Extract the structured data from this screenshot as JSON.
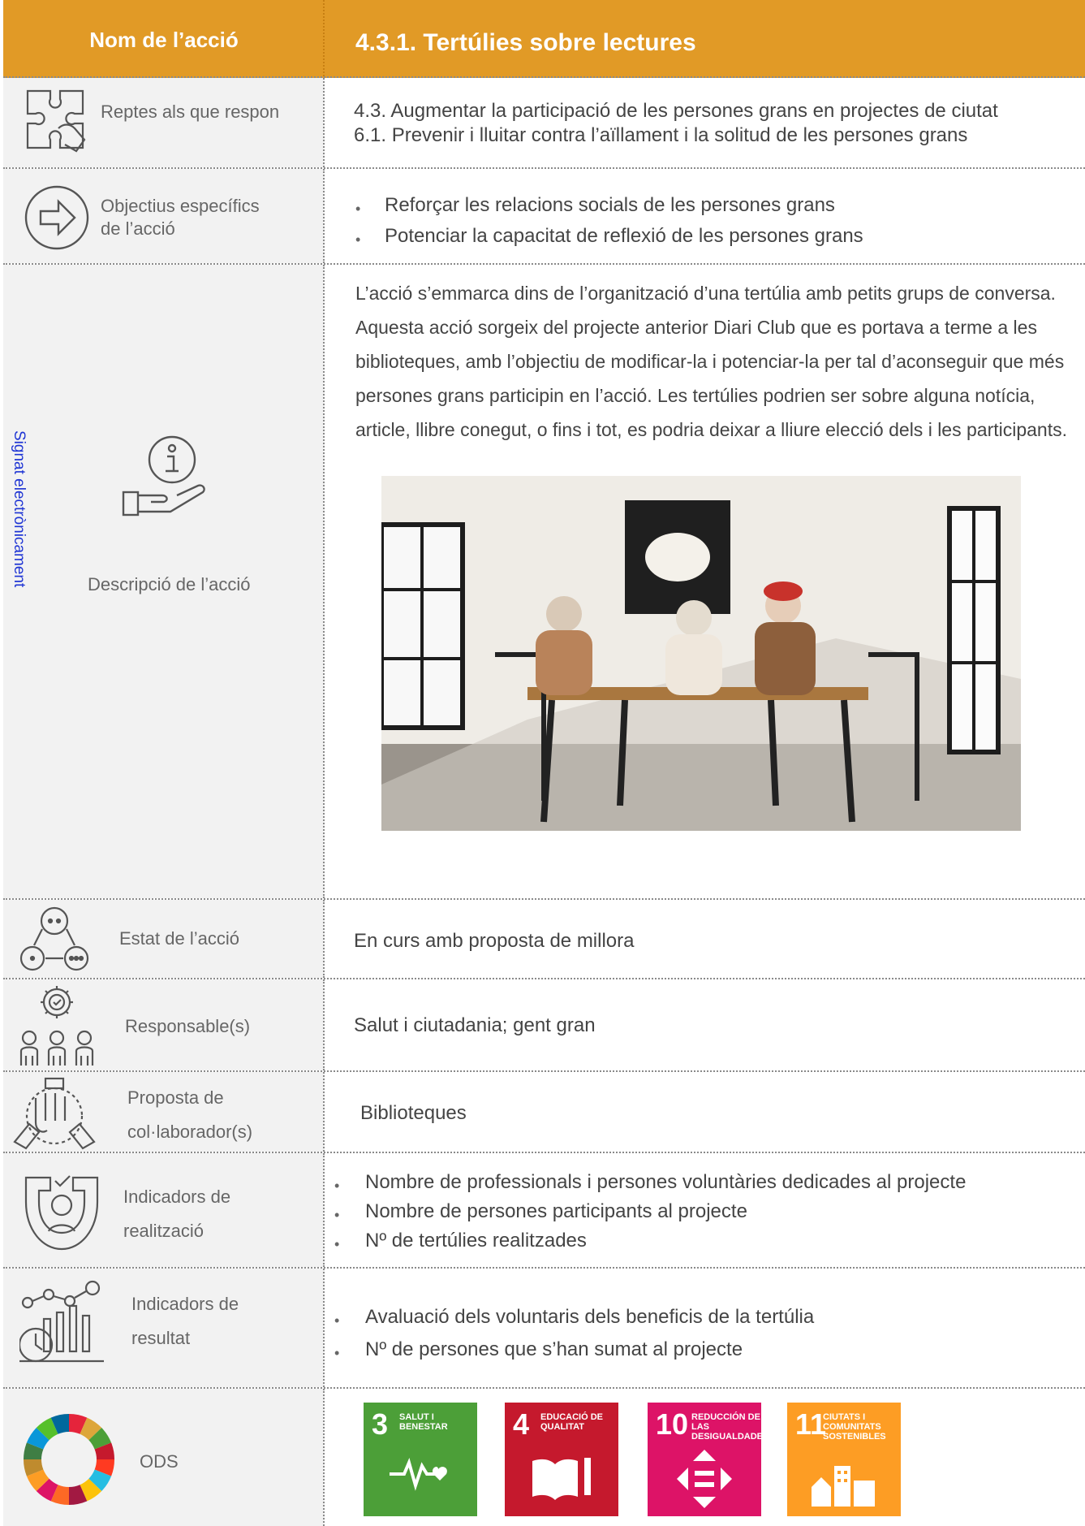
{
  "header": {
    "left": "Nom de l’acció",
    "right": "4.3.1. Tertúlies sobre lectures"
  },
  "side_stamp": "Signat electrònicament",
  "rows": {
    "reptes": {
      "label": "Reptes als que respon",
      "lines": [
        "4.3. Augmentar la participació de les persones grans en projectes de ciutat",
        "6.1. Prevenir i lluitar contra l’aïllament i la solitud de les persones grans"
      ]
    },
    "objectius": {
      "label": "Objectius específics de l’acció",
      "items": [
        "Reforçar les relacions socials de les persones grans",
        "Potenciar la capacitat de reflexió de les persones grans"
      ]
    },
    "descripcio": {
      "label": "Descripció de l’acció",
      "text": "L’acció s’emmarca dins de l’organització d’una tertúlia amb petits grups de conversa. Aquesta acció sorgeix del projecte anterior Diari Club que es portava a terme a les biblioteques, amb l’objectiu de modificar-la i potenciar-la per tal d’aconseguir que més persones grans participin en l’acció. Les tertúlies podrien ser sobre alguna notícia, article, llibre conegut, o fins i tot, es podria deixar a lliure elecció dels i les participants."
    },
    "estat": {
      "label": "Estat de l’acció",
      "value": "En curs amb proposta de millora"
    },
    "responsables": {
      "label": "Responsable(s)",
      "value": "Salut i ciutadania; gent gran"
    },
    "collaboradors": {
      "label_1": "Proposta de",
      "label_2": "col·laborador(s)",
      "value": "Biblioteques"
    },
    "realitzacio": {
      "label_1": "Indicadors de",
      "label_2": "realització",
      "items": [
        "Nombre de professionals i persones voluntàries dedicades al projecte",
        "Nombre de persones participants al projecte",
        "Nº de tertúlies realitzades"
      ]
    },
    "resultat": {
      "label_1": "Indicadors de",
      "label_2": "resultat",
      "items": [
        "Avaluació dels voluntaris dels beneficis de la tertúlia",
        "Nº de persones que s’han sumat al projecte"
      ]
    },
    "ods": {
      "label": "ODS"
    }
  },
  "sdg_goals": [
    {
      "number": "3",
      "title": "SALUT I BENESTAR",
      "color": "#4c9f38"
    },
    {
      "number": "4",
      "title": "EDUCACIÓ DE QUALITAT",
      "color": "#c5192d"
    },
    {
      "number": "10",
      "title": "REDUCCIÓN DE LAS DESIGUALDADES",
      "color": "#dd1367"
    },
    {
      "number": "11",
      "title": "CIUTATS I COMUNITATS SOSTENIBLES",
      "color": "#fd9d24"
    }
  ],
  "colors": {
    "header": "#e19a26",
    "label_bg": "#f2f2f2",
    "stamp": "#1f35d4"
  }
}
